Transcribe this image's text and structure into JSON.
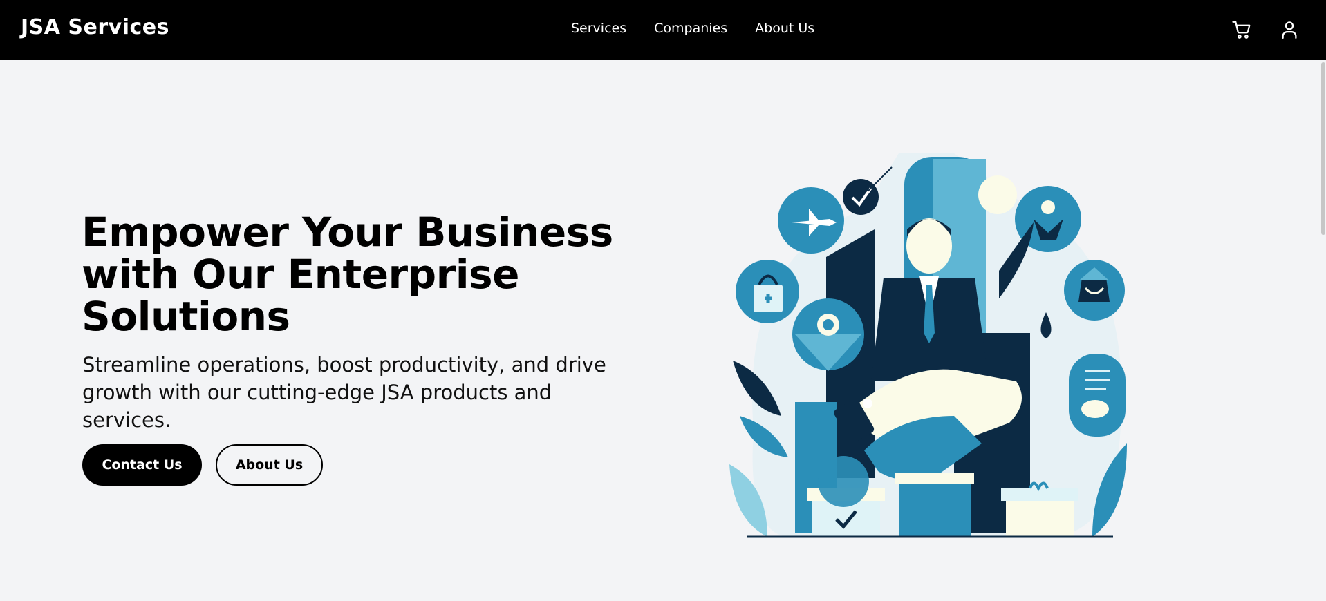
{
  "brand": {
    "name": "JSA Services"
  },
  "nav": {
    "items": [
      {
        "label": "Services"
      },
      {
        "label": "Companies"
      },
      {
        "label": "About Us"
      }
    ]
  },
  "header_icons": {
    "cart": "cart-icon",
    "user": "user-icon"
  },
  "hero": {
    "title": "Empower Your Business with Our Enterprise Solutions",
    "subtitle": "Streamline operations, boost productivity, and drive growth with our cutting-edge JSA products and services.",
    "primary_button": "Contact Us",
    "secondary_button": "About Us"
  },
  "colors": {
    "header_bg": "#000000",
    "page_bg": "#f3f4f6",
    "accent_blue": "#2b8fb8",
    "dark_navy": "#0c2a44",
    "light_blue": "#8fd0e2",
    "cream": "#fbfbe8"
  }
}
